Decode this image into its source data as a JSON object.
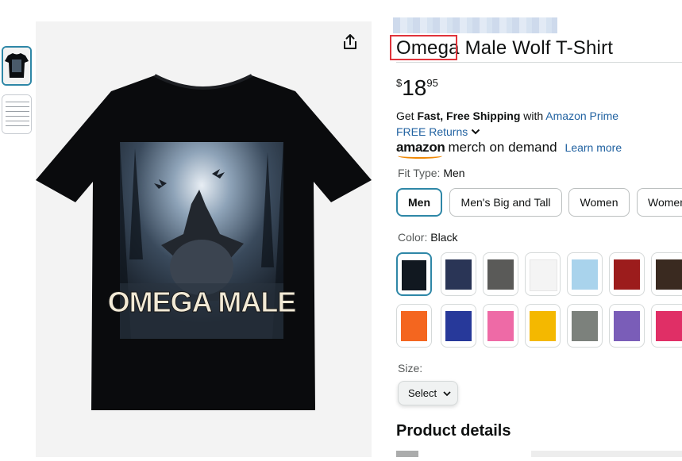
{
  "product": {
    "title_highlight": "Omega",
    "title_rest": " Male Wolf T-Shirt",
    "shirt_print_text": "OMEGA MALE"
  },
  "price": {
    "symbol": "$",
    "whole": "18",
    "fraction": "95"
  },
  "shipping": {
    "get": "Get ",
    "fast_free": "Fast, Free Shipping",
    "with": " with ",
    "prime_link": "Amazon Prime",
    "returns": "FREE Returns",
    "merch_brand": "amazon",
    "merch_text": "merch on demand",
    "learn_more": "Learn more"
  },
  "fit": {
    "label": "Fit Type: ",
    "value": "Men",
    "options": [
      "Men",
      "Men's Big and Tall",
      "Women",
      "Women"
    ]
  },
  "color": {
    "label": "Color: ",
    "value": "Black",
    "swatches": [
      "#111820",
      "#2a3556",
      "#5a5a58",
      "#f4f4f4",
      "#a9d3ec",
      "#9c1c1c",
      "#3a2a20",
      "#f4661f",
      "#27399a",
      "#ee6aa6",
      "#f4b800",
      "#7c817c",
      "#7a5db8",
      "#e02f66"
    ]
  },
  "size": {
    "label": "Size:",
    "select_label": "Select"
  },
  "details": {
    "heading": "Product details"
  }
}
